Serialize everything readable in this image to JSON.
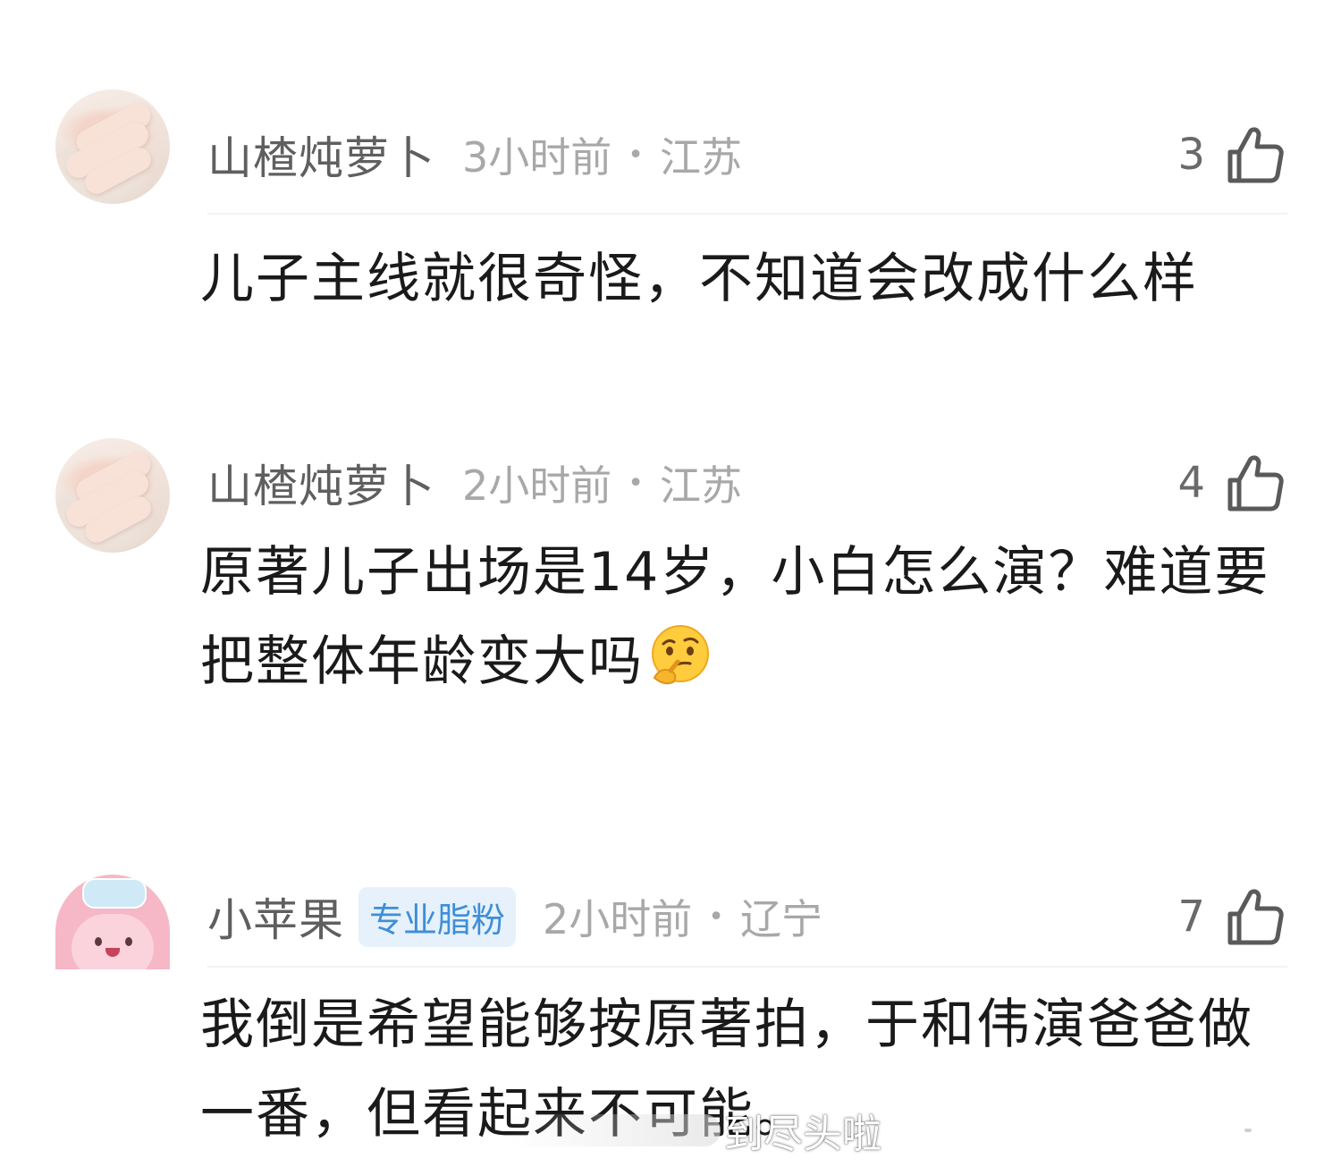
{
  "comments": [
    {
      "username": "山楂炖萝卜",
      "time": "3小时前",
      "separator": "•",
      "region": "江苏",
      "likes": "3",
      "text": "儿子主线就很奇怪，不知道会改成什么样",
      "avatar_icon": "hand-photo-avatar"
    },
    {
      "username": "山楂炖萝卜",
      "time": "2小时前",
      "separator": "•",
      "region": "江苏",
      "likes": "4",
      "text": "原著儿子出场是14岁，小白怎么演？难道要把整体年龄变大吗",
      "emoji": "thinking-face-emoji",
      "avatar_icon": "hand-photo-avatar"
    },
    {
      "username": "小苹果",
      "badge": "专业脂粉",
      "time": "2小时前",
      "separator": "•",
      "region": "辽宁",
      "likes": "7",
      "text": "我倒是希望能够按原著拍，于和伟演爸爸做一番，但看起来不可能。",
      "avatar_icon": "pink-pig-avatar"
    }
  ],
  "watermark": {
    "text": "到尽头啦"
  },
  "icons": {
    "like": "thumbs-up-icon"
  },
  "colors": {
    "username": "#5f5f5f",
    "meta": "#a8a8a8",
    "badge_text": "#3e8ed8",
    "badge_bg": "#e6f1fb",
    "body_text": "#1a1a1a"
  }
}
